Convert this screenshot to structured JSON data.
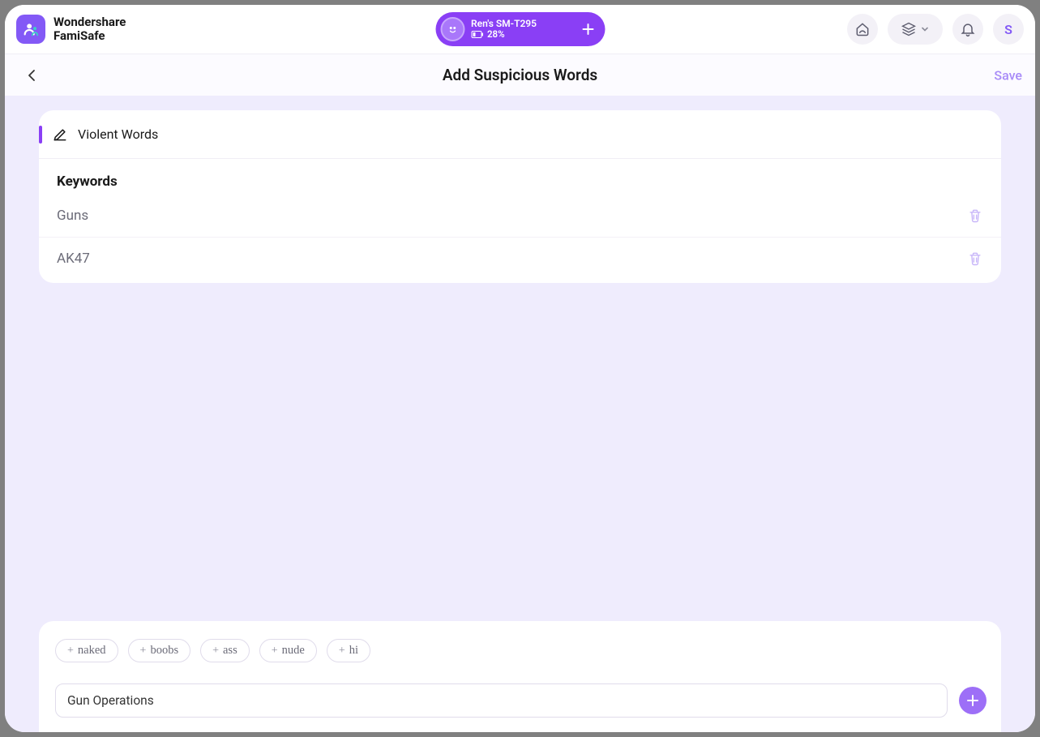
{
  "header": {
    "brand_line1": "Wondershare",
    "brand_line2": "FamiSafe",
    "device": {
      "name": "Ren's SM-T295",
      "battery": "28%"
    },
    "avatar_letter": "S"
  },
  "titlebar": {
    "title": "Add Suspicious Words",
    "save_label": "Save"
  },
  "category": {
    "name": "Violent Words"
  },
  "keywords": {
    "heading": "Keywords",
    "items": [
      {
        "text": "Guns"
      },
      {
        "text": "AK47"
      }
    ]
  },
  "suggestions": [
    "naked",
    "boobs",
    "ass",
    "nude",
    "hi"
  ],
  "input": {
    "value": "Gun Operations"
  }
}
